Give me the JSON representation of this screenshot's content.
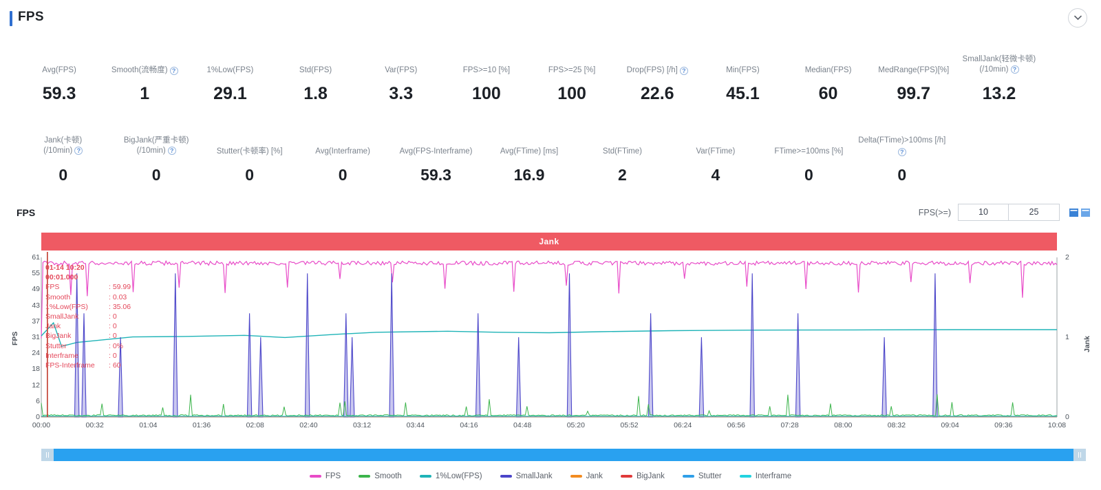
{
  "header": {
    "title": "FPS",
    "collapse_icon": "chevron-down-icon",
    "accent_color": "#2f6fd0"
  },
  "metrics_row1": [
    {
      "label": "Avg(FPS)",
      "value": "59.3",
      "info": false
    },
    {
      "label": "Smooth(流畅度)",
      "value": "1",
      "info": true
    },
    {
      "label": "1%Low(FPS)",
      "value": "29.1",
      "info": false
    },
    {
      "label": "Std(FPS)",
      "value": "1.8",
      "info": false
    },
    {
      "label": "Var(FPS)",
      "value": "3.3",
      "info": false
    },
    {
      "label": "FPS>=10 [%]",
      "value": "100",
      "info": false
    },
    {
      "label": "FPS>=25 [%]",
      "value": "100",
      "info": false
    },
    {
      "label": "Drop(FPS) [/h]",
      "value": "22.6",
      "info": true
    },
    {
      "label": "Min(FPS)",
      "value": "45.1",
      "info": false
    },
    {
      "label": "Median(FPS)",
      "value": "60",
      "info": false
    },
    {
      "label": "MedRange(FPS)[%]",
      "value": "99.7",
      "info": false
    },
    {
      "label": "SmallJank(轻微卡顿)",
      "label2": "(/10min)",
      "value": "13.2",
      "info": true
    }
  ],
  "metrics_row2": [
    {
      "label": "Jank(卡顿)",
      "label2": "(/10min)",
      "value": "0",
      "info": true
    },
    {
      "label": "BigJank(严重卡顿)",
      "label2": "(/10min)",
      "value": "0",
      "info": true
    },
    {
      "label": "Stutter(卡顿率) [%]",
      "value": "0",
      "info": false
    },
    {
      "label": "Avg(Interframe)",
      "value": "0",
      "info": false
    },
    {
      "label": "Avg(FPS-Interframe)",
      "value": "59.3",
      "info": false
    },
    {
      "label": "Avg(FTime) [ms]",
      "value": "16.9",
      "info": false
    },
    {
      "label": "Std(FTime)",
      "value": "2",
      "info": false
    },
    {
      "label": "Var(FTime)",
      "value": "4",
      "info": false
    },
    {
      "label": "FTime>=100ms [%]",
      "value": "0",
      "info": false
    },
    {
      "label": "Delta(FTime)>100ms [/h]",
      "value": "0",
      "info": true
    },
    {
      "label": "",
      "value": "",
      "info": false
    }
  ],
  "chart_panel": {
    "title": "FPS",
    "fps_gte_label": "FPS(>=)",
    "threshold_low": "10",
    "threshold_high": "25",
    "icon_left": "chart-bar-icon",
    "icon_right": "chart-area-icon",
    "banner_text": "Jank",
    "banner_color": "#ef5a63"
  },
  "tooltip": {
    "date": "01-14 10:20",
    "time": "00:01.000",
    "rows": [
      {
        "key": "FPS",
        "value": "59.99"
      },
      {
        "key": "Smooth",
        "value": "0.03"
      },
      {
        "key": "1%Low(FPS)",
        "value": "35.06"
      },
      {
        "key": "SmallJank",
        "value": "0"
      },
      {
        "key": "Jank",
        "value": "0"
      },
      {
        "key": "BigJank",
        "value": "0"
      },
      {
        "key": "Stutter",
        "value": "0%"
      },
      {
        "key": "Interframe",
        "value": "0"
      },
      {
        "key": "FPS-Interframe",
        "value": "60"
      }
    ]
  },
  "chart_data": {
    "type": "line",
    "title": "FPS",
    "xlabel": "",
    "ylabel": "FPS",
    "y2label": "Jank",
    "ylim": [
      0,
      61
    ],
    "y2lim": [
      0,
      2
    ],
    "yticks": [
      61,
      55,
      49,
      43,
      37,
      31,
      24,
      18,
      12,
      6,
      0
    ],
    "y2ticks": [
      2,
      1,
      0
    ],
    "xticks": [
      "00:00",
      "00:32",
      "01:04",
      "01:36",
      "02:08",
      "02:40",
      "03:12",
      "03:44",
      "04:16",
      "04:48",
      "05:20",
      "05:52",
      "06:24",
      "06:56",
      "07:28",
      "08:00",
      "08:32",
      "09:04",
      "09:36",
      "10:08"
    ],
    "grid": false,
    "legend_position": "bottom",
    "series": [
      {
        "name": "FPS",
        "color": "#e84bc8",
        "baseline": 58.5,
        "type": "noisy-line"
      },
      {
        "name": "Smooth",
        "color": "#3cb44b",
        "baseline": 1.2,
        "type": "spiky-low"
      },
      {
        "name": "1%Low(FPS)",
        "color": "#1eb3b7",
        "baseline": 30.5,
        "type": "step-line"
      },
      {
        "name": "SmallJank",
        "color": "#4b45c9",
        "baseline": 0,
        "type": "spikes"
      },
      {
        "name": "Jank",
        "color": "#f28b20",
        "baseline": 0,
        "type": "flat"
      },
      {
        "name": "BigJank",
        "color": "#e03a3a",
        "baseline": 0,
        "type": "flat"
      },
      {
        "name": "Stutter",
        "color": "#2f9fe8",
        "baseline": 0,
        "type": "flat"
      },
      {
        "name": "Interframe",
        "color": "#22d3e0",
        "baseline": 0,
        "type": "flat"
      }
    ]
  },
  "legend": [
    {
      "label": "FPS",
      "color": "#e84bc8"
    },
    {
      "label": "Smooth",
      "color": "#3cb44b"
    },
    {
      "label": "1%Low(FPS)",
      "color": "#1eb3b7"
    },
    {
      "label": "SmallJank",
      "color": "#4b45c9"
    },
    {
      "label": "Jank",
      "color": "#f28b20"
    },
    {
      "label": "BigJank",
      "color": "#e03a3a"
    },
    {
      "label": "Stutter",
      "color": "#2f9fe8"
    },
    {
      "label": "Interframe",
      "color": "#22d3e0"
    }
  ],
  "scrollbar": {
    "color": "#29a1f0",
    "handle_color": "#bfd7e8"
  }
}
